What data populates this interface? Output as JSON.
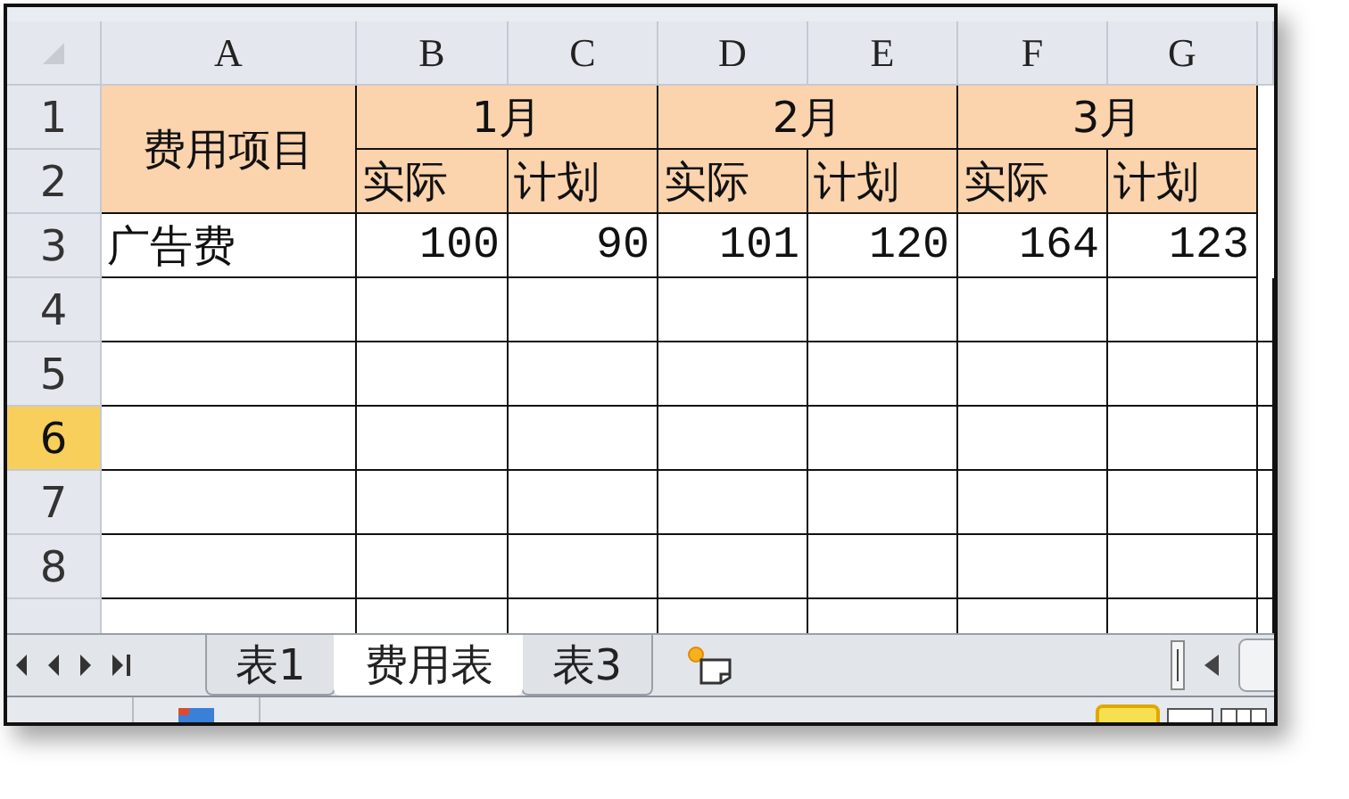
{
  "columns": [
    {
      "label": "A",
      "selected": false
    },
    {
      "label": "B",
      "selected": false
    },
    {
      "label": "C",
      "selected": false
    },
    {
      "label": "D",
      "selected": false
    },
    {
      "label": "E",
      "selected": false
    },
    {
      "label": "F",
      "selected": false
    },
    {
      "label": "G",
      "selected": false
    }
  ],
  "row_headers": [
    {
      "label": "1",
      "selected": false
    },
    {
      "label": "2",
      "selected": false
    },
    {
      "label": "3",
      "selected": false
    },
    {
      "label": "4",
      "selected": false
    },
    {
      "label": "5",
      "selected": false
    },
    {
      "label": "6",
      "selected": true
    },
    {
      "label": "7",
      "selected": false
    },
    {
      "label": "8",
      "selected": false
    }
  ],
  "header": {
    "item_label": "费用项目",
    "months": [
      {
        "label": "1月",
        "subcolumns": [
          "实际",
          "计划"
        ]
      },
      {
        "label": "2月",
        "subcolumns": [
          "实际",
          "计划"
        ]
      },
      {
        "label": "3月",
        "subcolumns": [
          "实际",
          "计划"
        ]
      }
    ]
  },
  "rows": [
    {
      "item": "广告费",
      "values": [
        "100",
        "90",
        "101",
        "120",
        "164",
        "123"
      ]
    }
  ],
  "tabs": [
    {
      "label": "表1",
      "selected": false
    },
    {
      "label": "费用表",
      "selected": true
    },
    {
      "label": "表3",
      "selected": false
    }
  ]
}
